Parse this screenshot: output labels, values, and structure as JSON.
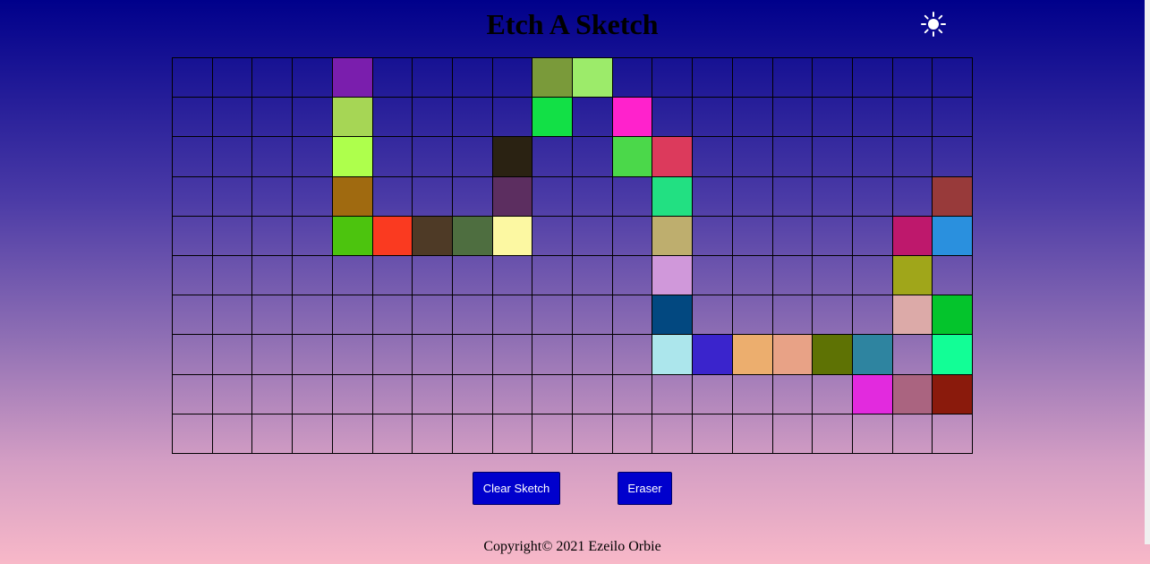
{
  "header": {
    "title": "Etch A Sketch",
    "theme_icon": "sun-icon"
  },
  "grid": {
    "columns": 20,
    "rows": 10,
    "colored_cells": [
      {
        "row": 0,
        "col": 4,
        "color": "#7a1ead"
      },
      {
        "row": 0,
        "col": 9,
        "color": "#7a9a3a"
      },
      {
        "row": 0,
        "col": 10,
        "color": "#9ceb6a"
      },
      {
        "row": 1,
        "col": 4,
        "color": "#a6d655"
      },
      {
        "row": 1,
        "col": 9,
        "color": "#12e046"
      },
      {
        "row": 1,
        "col": 11,
        "color": "#ff22cc"
      },
      {
        "row": 2,
        "col": 4,
        "color": "#aeff4c"
      },
      {
        "row": 2,
        "col": 8,
        "color": "#2a2212"
      },
      {
        "row": 2,
        "col": 11,
        "color": "#4bd84a"
      },
      {
        "row": 2,
        "col": 12,
        "color": "#dc3a5c"
      },
      {
        "row": 3,
        "col": 4,
        "color": "#a06a10"
      },
      {
        "row": 3,
        "col": 8,
        "color": "#5c2e60"
      },
      {
        "row": 3,
        "col": 12,
        "color": "#22e082"
      },
      {
        "row": 3,
        "col": 19,
        "color": "#983a3a"
      },
      {
        "row": 4,
        "col": 4,
        "color": "#4cc40e"
      },
      {
        "row": 4,
        "col": 5,
        "color": "#fa3a20"
      },
      {
        "row": 4,
        "col": 6,
        "color": "#4e3a26"
      },
      {
        "row": 4,
        "col": 7,
        "color": "#4e6e40"
      },
      {
        "row": 4,
        "col": 8,
        "color": "#fcf8a2"
      },
      {
        "row": 4,
        "col": 12,
        "color": "#beae6e"
      },
      {
        "row": 4,
        "col": 18,
        "color": "#be186c"
      },
      {
        "row": 4,
        "col": 19,
        "color": "#2a90de"
      },
      {
        "row": 5,
        "col": 12,
        "color": "#d098da"
      },
      {
        "row": 5,
        "col": 18,
        "color": "#a0a61a"
      },
      {
        "row": 6,
        "col": 12,
        "color": "#024880"
      },
      {
        "row": 6,
        "col": 18,
        "color": "#dcaaa8"
      },
      {
        "row": 6,
        "col": 19,
        "color": "#04c42c"
      },
      {
        "row": 7,
        "col": 12,
        "color": "#ace6ec"
      },
      {
        "row": 7,
        "col": 13,
        "color": "#3a24cc"
      },
      {
        "row": 7,
        "col": 14,
        "color": "#ecae6e"
      },
      {
        "row": 7,
        "col": 15,
        "color": "#e8a286"
      },
      {
        "row": 7,
        "col": 16,
        "color": "#5e7204"
      },
      {
        "row": 7,
        "col": 17,
        "color": "#2e84a0"
      },
      {
        "row": 7,
        "col": 19,
        "color": "#12fe96"
      },
      {
        "row": 8,
        "col": 17,
        "color": "#e22ade"
      },
      {
        "row": 8,
        "col": 18,
        "color": "#aa6480"
      },
      {
        "row": 8,
        "col": 19,
        "color": "#8a1a0c"
      }
    ]
  },
  "controls": {
    "clear_label": "Clear Sketch",
    "eraser_label": "Eraser"
  },
  "footer": {
    "copyright": "Copyright© 2021 Ezeilo Orbie"
  },
  "colors": {
    "button_bg": "#0000cd",
    "gradient_top": "#00008b",
    "gradient_bottom": "#f8b8c8"
  }
}
